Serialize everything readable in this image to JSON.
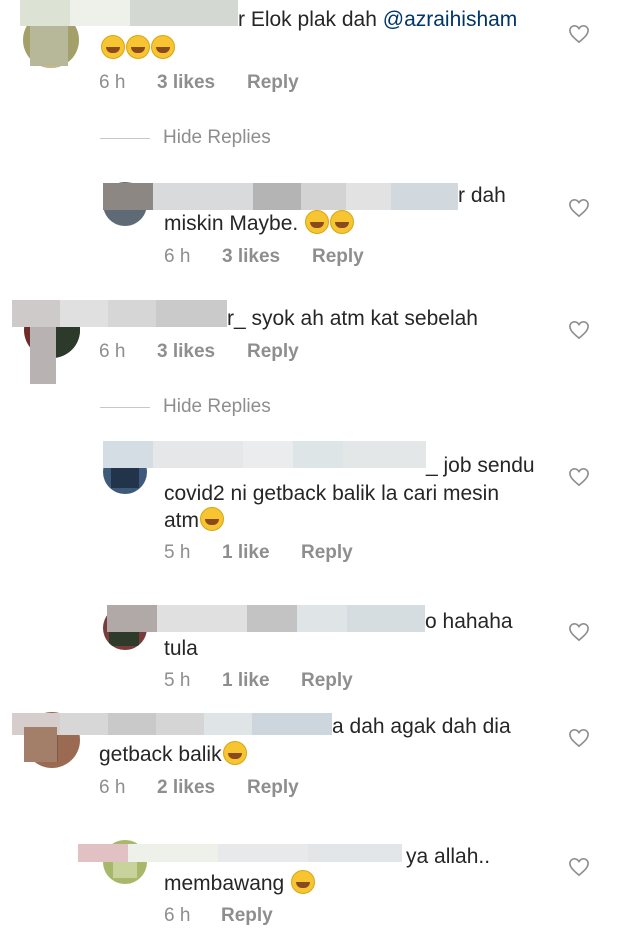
{
  "comments": [
    {
      "text": "r Elok plak dah",
      "mention": "@azraihisham",
      "emoji_count": 3,
      "time": "6 h",
      "likes": "3 likes",
      "reply": "Reply"
    },
    {
      "text_line1": "r dah",
      "text_line2": "miskin Maybe.",
      "emoji_count": 2,
      "time": "6 h",
      "likes": "3 likes",
      "reply": "Reply"
    },
    {
      "text": "r_ syok ah atm kat sebelah",
      "time": "6 h",
      "likes": "3 likes",
      "reply": "Reply"
    },
    {
      "text_line1": "_ job sendu",
      "text_line2": "covid2 ni getback balik la cari mesin",
      "text_line3": "atm",
      "emoji_count": 1,
      "time": "5 h",
      "likes": "1 like",
      "reply": "Reply"
    },
    {
      "text_line1": "o hahaha",
      "text_line2": "tula",
      "time": "5 h",
      "likes": "1 like",
      "reply": "Reply"
    },
    {
      "text_line1": "a dah agak dah dia",
      "text_line2": "getback balik",
      "emoji_count": 1,
      "time": "6 h",
      "likes": "2 likes",
      "reply": "Reply"
    },
    {
      "text_line1": "ya allah..",
      "text_line2": "membawang",
      "emoji_count": 1,
      "time": "6 h",
      "reply": "Reply"
    }
  ],
  "hide_replies_label": "Hide Replies",
  "colors": {
    "text": "#262626",
    "meta": "#8e8e8e",
    "mention": "#003569",
    "background": "#ffffff"
  }
}
